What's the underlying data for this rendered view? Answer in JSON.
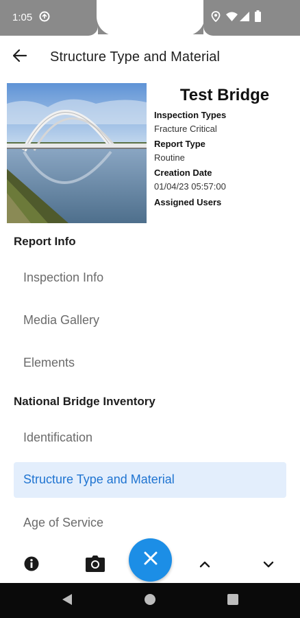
{
  "status_bar": {
    "time": "1:05",
    "icons": [
      "sync-icon",
      "location-icon",
      "wifi-icon",
      "signal-icon",
      "battery-icon"
    ]
  },
  "app_bar": {
    "back_icon": "arrow-back-icon",
    "title": "Structure Type and Material"
  },
  "header": {
    "bridge_name": "Test Bridge",
    "photo_description": "bridge-photo",
    "fields": [
      {
        "label": "Inspection Types",
        "value": "Fracture Critical"
      },
      {
        "label": "Report Type",
        "value": "Routine"
      },
      {
        "label": "Creation Date",
        "value": "01/04/23 05:57:00"
      },
      {
        "label": "Assigned Users",
        "value": ""
      }
    ]
  },
  "sections": [
    {
      "title": "Report Info",
      "items": [
        {
          "label": "Inspection Info",
          "active": false
        },
        {
          "label": "Media Gallery",
          "active": false
        },
        {
          "label": "Elements",
          "active": false
        }
      ]
    },
    {
      "title": "National Bridge Inventory",
      "items": [
        {
          "label": "Identification",
          "active": false
        },
        {
          "label": "Structure Type and Material",
          "active": true
        },
        {
          "label": "Age of Service",
          "active": false
        }
      ]
    }
  ],
  "toolbar": {
    "items": [
      "info-icon",
      "camera-icon",
      "close-icon",
      "chevron-up-icon",
      "chevron-down-icon"
    ]
  },
  "colors": {
    "accent": "#1c8ee6",
    "active_bg": "#e3eefc",
    "active_text": "#1f74d1",
    "status_bar": "#8a8a8a"
  }
}
